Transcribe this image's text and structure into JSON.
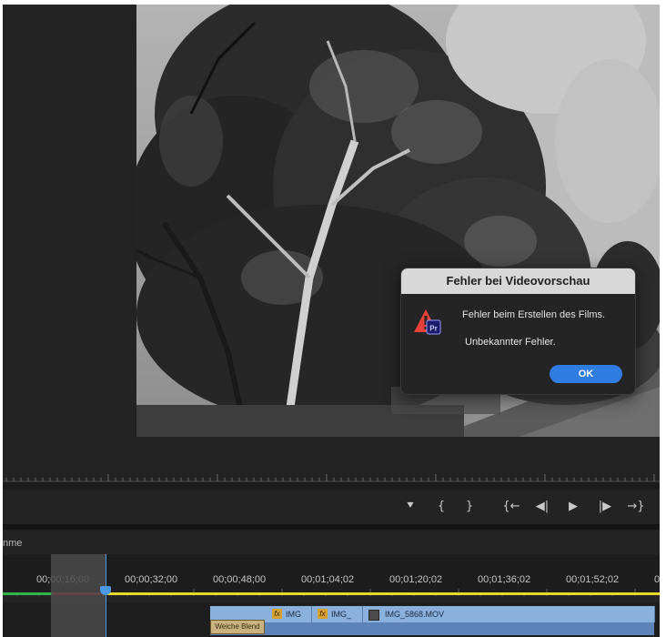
{
  "dialog": {
    "title": "Fehler bei Videovorschau",
    "message": "Fehler beim Erstellen des Films.",
    "detail": "Unbekannter Fehler.",
    "ok_label": "OK",
    "icon": "premiere-warning-icon",
    "icon_badge": "Pr",
    "accent": "#2f7de2",
    "warning_color": "#e8413a"
  },
  "transport": {
    "buttons": [
      {
        "name": "add-marker-button",
        "glyph": "⯆"
      },
      {
        "name": "mark-in-button",
        "glyph": "{"
      },
      {
        "name": "mark-out-button",
        "glyph": "}"
      },
      {
        "name": "go-to-in-button",
        "glyph": "{←"
      },
      {
        "name": "step-back-button",
        "glyph": "◀|"
      },
      {
        "name": "play-button",
        "glyph": "▶"
      },
      {
        "name": "step-forward-button",
        "glyph": "|▶"
      },
      {
        "name": "go-to-out-button",
        "glyph": "→}"
      }
    ]
  },
  "timeline": {
    "panel_label": "nme",
    "timecodes": [
      "00;00;16;00",
      "00;00;32;00",
      "00;00;48;00",
      "00;01;04;02",
      "00;01;20;02",
      "00;01;36;02",
      "00;01;52;02",
      "0"
    ],
    "transition_label": "Weiche Blend",
    "clips": [
      {
        "name": "IMG",
        "icon": "fx-icon"
      },
      {
        "name": "IMG_",
        "icon": "fx-icon"
      },
      {
        "name": "IMG_5868.MOV",
        "icon": "clip-icon"
      }
    ],
    "fx_label": "fx",
    "playhead_color": "#4b98e8"
  }
}
